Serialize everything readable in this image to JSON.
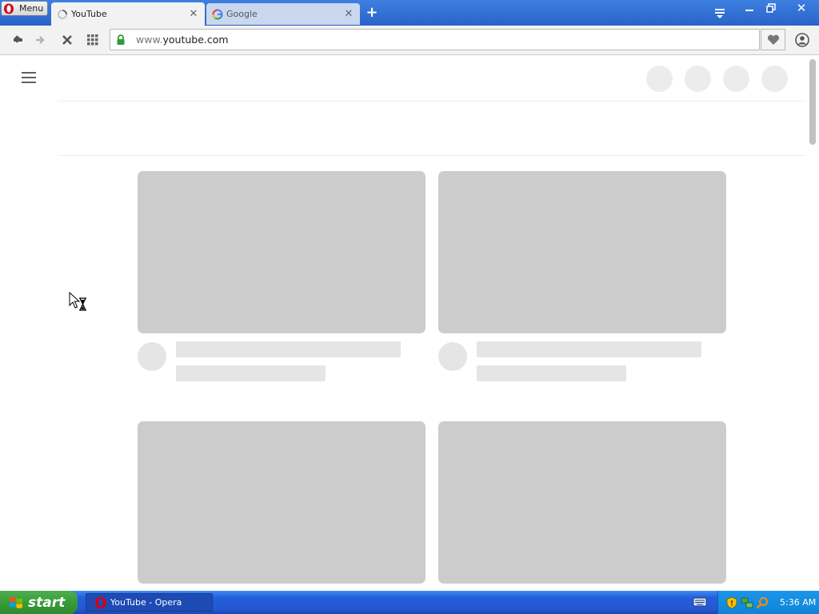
{
  "browser": {
    "menu_label": "Menu",
    "tabs": [
      {
        "title": "YouTube",
        "icon": "loading-spinner-icon",
        "active": true
      },
      {
        "title": "Google",
        "icon": "google-g-icon",
        "active": false
      }
    ],
    "url": {
      "prefix": "www.",
      "domain": "youtube.com"
    }
  },
  "taskbar": {
    "start_label": "start",
    "tasks": [
      {
        "title": "YouTube - Opera",
        "icon": "opera-icon"
      }
    ],
    "clock": "5:36 AM"
  },
  "colors": {
    "placeholder_thumb": "#cccccc",
    "placeholder_line": "#e5e5e5",
    "placeholder_header_circle": "#ececec",
    "titlebar_blue": "#2a63c9",
    "taskbar_blue": "#245edb",
    "start_green": "#379c37"
  },
  "page_state": "loading-skeleton"
}
